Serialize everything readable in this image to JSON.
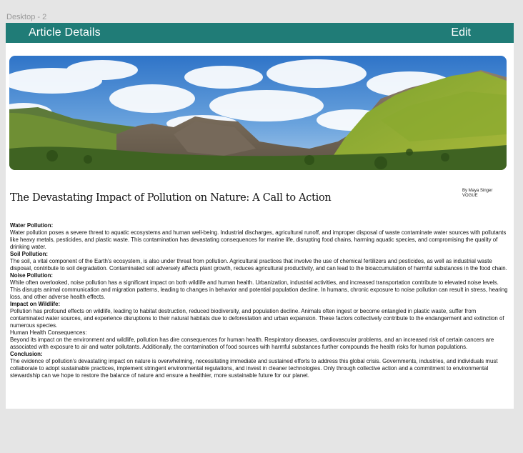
{
  "canvas": {
    "label": "Desktop - 2"
  },
  "header": {
    "title": "Article Details",
    "edit_label": "Edit"
  },
  "colors": {
    "header_bg": "#207c77",
    "page_bg": "#ffffff",
    "canvas_bg": "#e5e5e5"
  },
  "article": {
    "title": "The Devastating Impact of Pollution on Nature: A Call to Action",
    "byline_author": "By Maya Singer",
    "byline_source": "VOGUE",
    "sections": [
      {
        "heading": "Water Pollution:",
        "text": "Water pollution poses a severe threat to aquatic ecosystems and human well-being. Industrial discharges, agricultural runoff, and improper disposal of waste contaminate water sources with pollutants like heavy metals, pesticides, and plastic waste. This contamination has devastating consequences for marine life, disrupting food chains, harming aquatic species, and compromising the quality of drinking water."
      },
      {
        "heading": "Soil Pollution:",
        "text": "The soil, a vital component of the Earth's ecosystem, is also under threat from pollution. Agricultural practices that involve the use of chemical fertilizers and pesticides, as well as industrial waste disposal, contribute to soil degradation. Contaminated soil adversely affects plant growth, reduces agricultural productivity, and can lead to the bioaccumulation of harmful substances in the food chain."
      },
      {
        "heading": "Noise Pollution:",
        "text": "While often overlooked, noise pollution has a significant impact on both wildlife and human health. Urbanization, industrial activities, and increased transportation contribute to elevated noise levels. This disrupts animal communication and migration patterns, leading to changes in behavior and potential population decline. In humans, chronic exposure to noise pollution can result in stress, hearing loss, and other adverse health effects."
      },
      {
        "heading": "Impact on Wildlife:",
        "text": "Pollution has profound effects on wildlife, leading to habitat destruction, reduced biodiversity, and population decline. Animals often ingest or become entangled in plastic waste, suffer from contaminated water sources, and experience disruptions to their natural habitats due to deforestation and urban expansion. These factors collectively contribute to the endangerment and extinction of numerous species."
      },
      {
        "heading": "Human Health Consequences:",
        "text": "Beyond its impact on the environment and wildlife, pollution has dire consequences for human health. Respiratory diseases, cardiovascular problems, and an increased risk of certain cancers are associated with exposure to air and water pollutants. Additionally, the contamination of food sources with harmful substances further compounds the health risks for human populations."
      },
      {
        "heading": "Conclusion:",
        "text": "The evidence of pollution's devastating impact on nature is overwhelming, necessitating immediate and sustained efforts to address this global crisis. Governments, industries, and individuals must collaborate to adopt sustainable practices, implement stringent environmental regulations, and invest in cleaner technologies. Only through collective action and a commitment to environmental stewardship can we hope to restore the balance of nature and ensure a healthier, more sustainable future for our planet."
      }
    ]
  }
}
